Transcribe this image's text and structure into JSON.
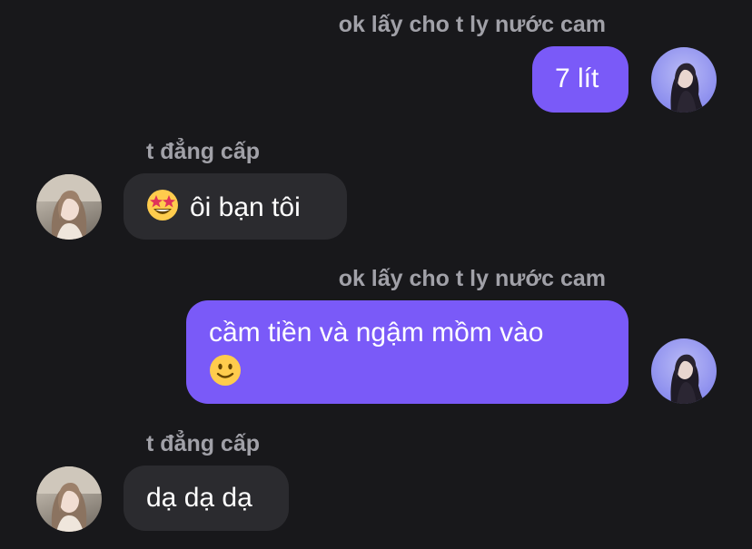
{
  "messages": [
    {
      "sender": "ok lấy cho t ly nước cam",
      "text": "7 lít",
      "direction": "out"
    },
    {
      "sender": "t đẳng cấp",
      "emoji": "star-struck-emoji",
      "text": "ôi bạn tôi",
      "direction": "in"
    },
    {
      "sender": "ok lấy cho t ly nước cam",
      "text": "cầm tiền và ngậm mồm vào",
      "emoji": "slightly-smiling-face-emoji",
      "direction": "out"
    },
    {
      "sender": "t đẳng cấp",
      "text": "dạ dạ dạ",
      "direction": "in"
    }
  ],
  "colors": {
    "background": "#18181b",
    "outgoing_bubble": "#7a5af8",
    "incoming_bubble": "#2b2b2f",
    "sender_label": "#a1a1a8",
    "message_text": "#ffffff"
  }
}
